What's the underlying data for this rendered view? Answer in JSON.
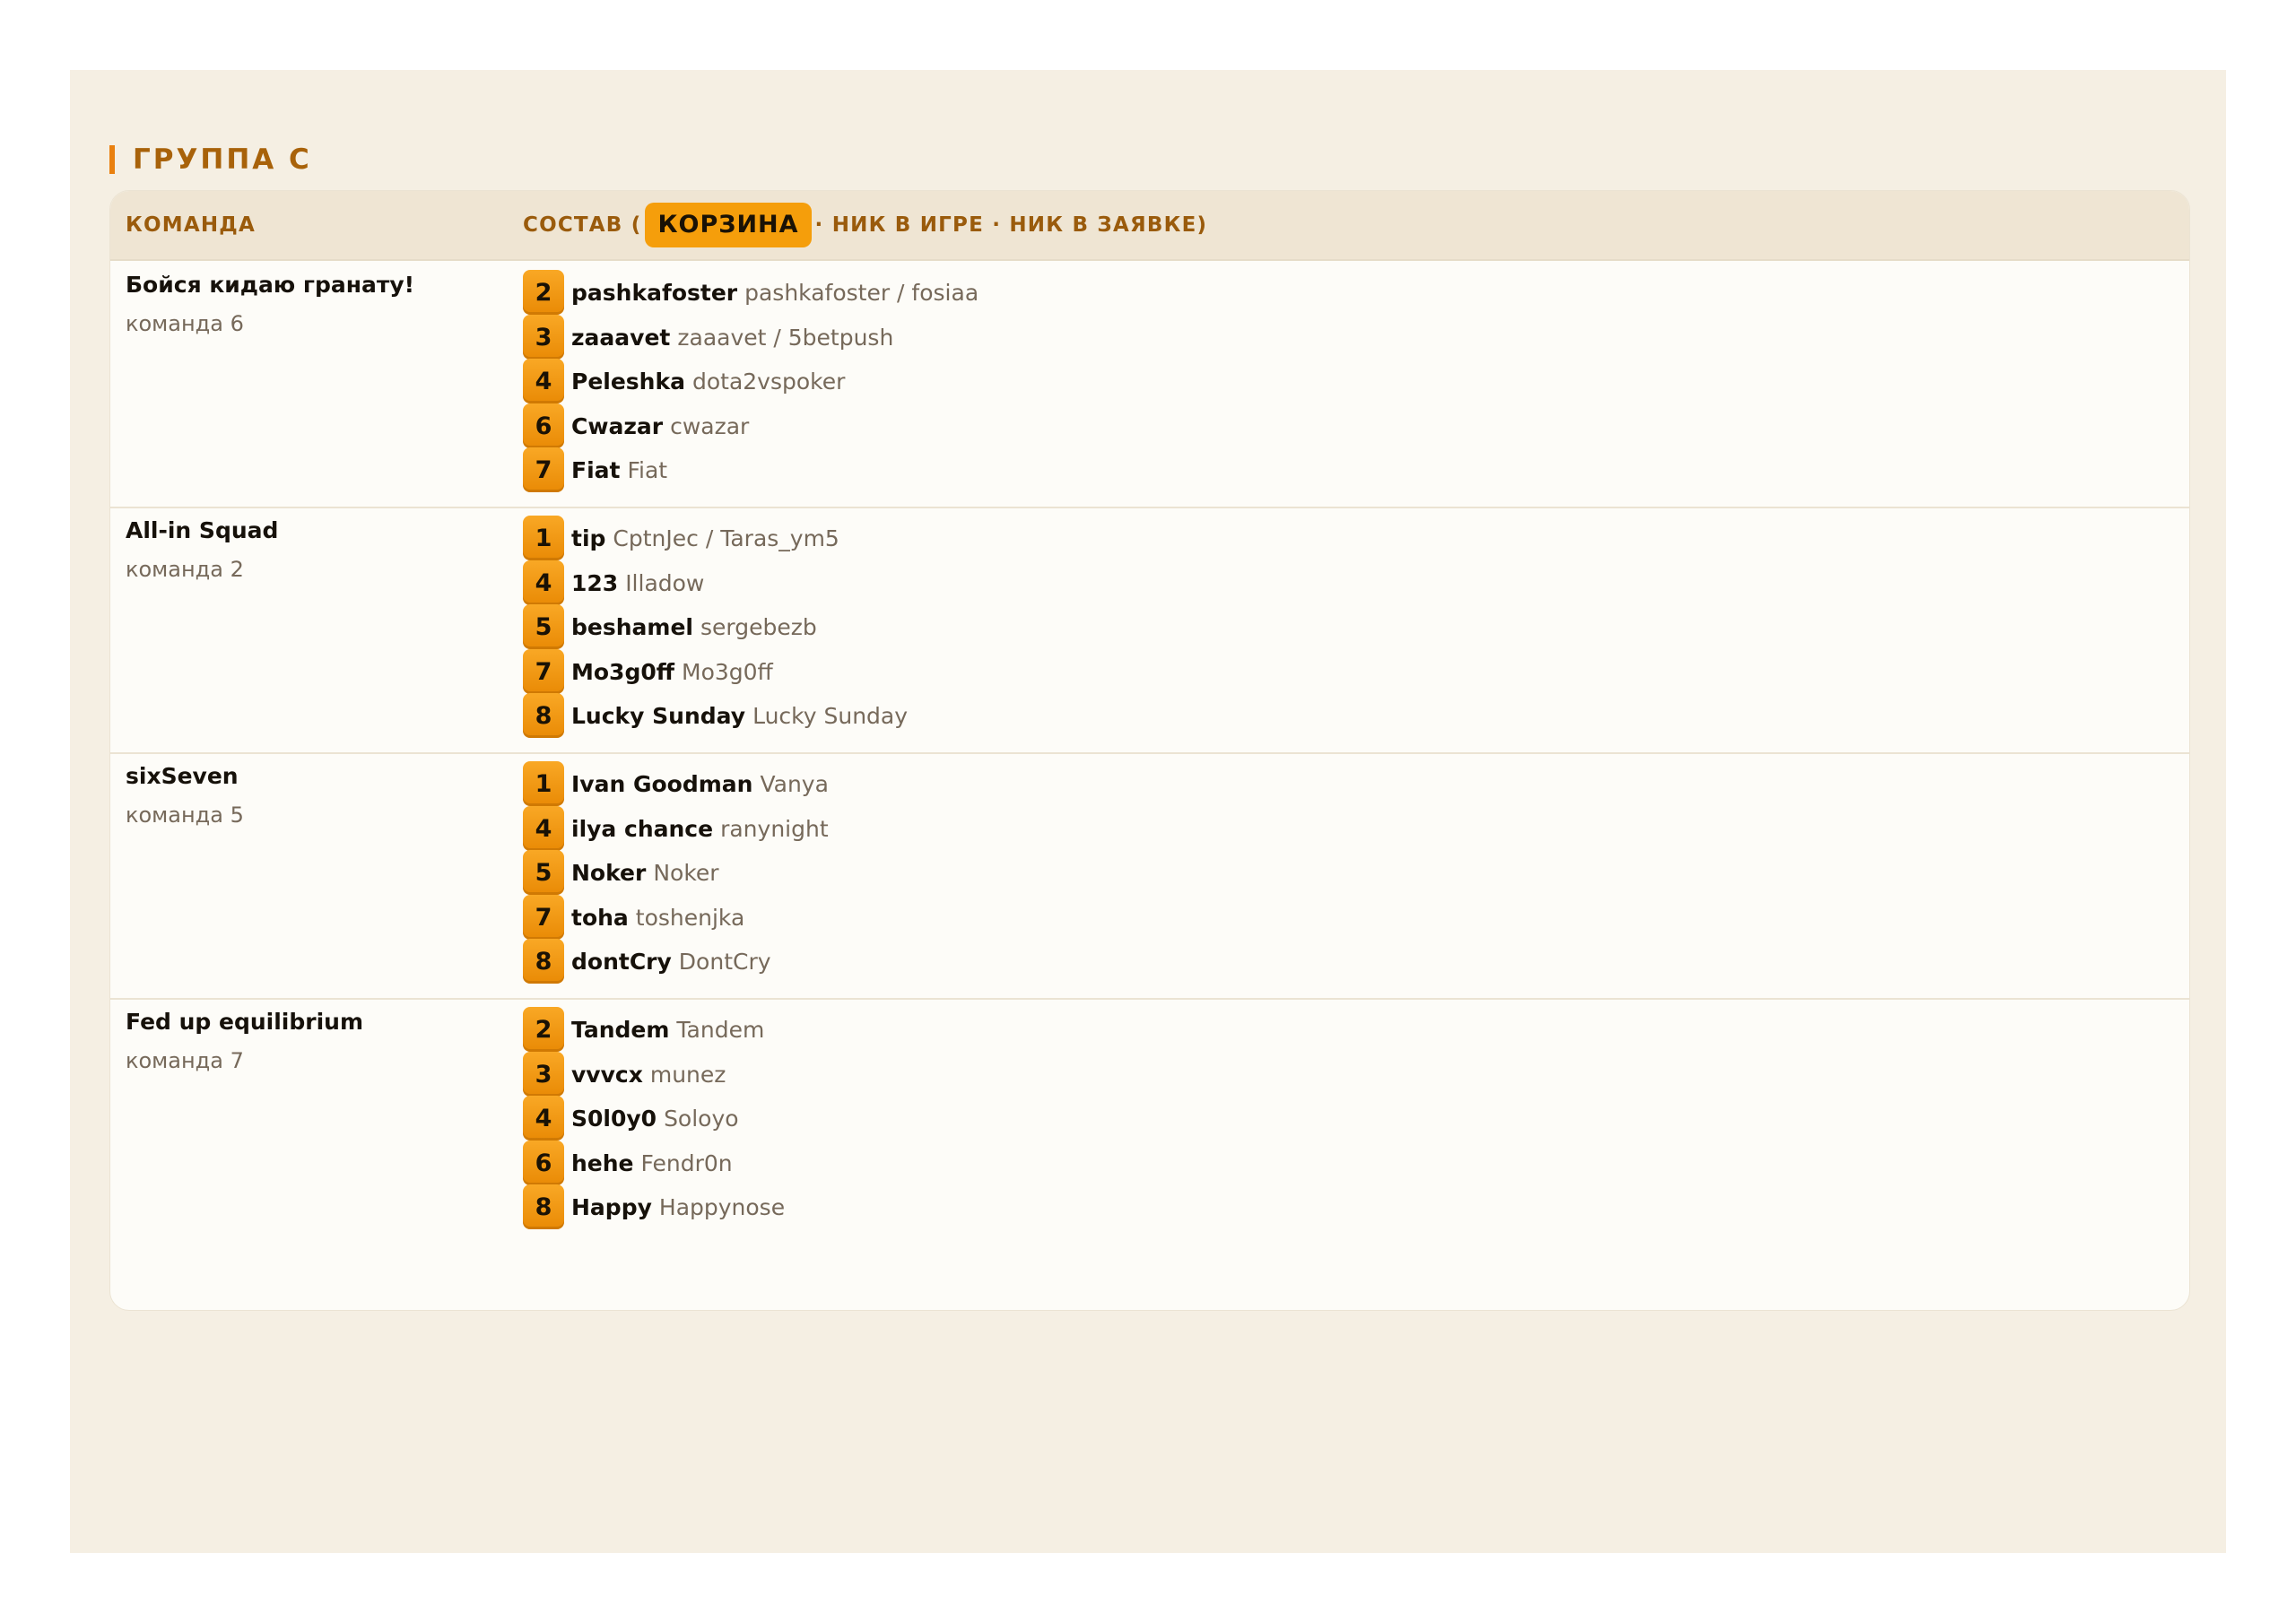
{
  "group": {
    "title": "ГРУППА C"
  },
  "table": {
    "header": {
      "team": "КОМАНДА",
      "roster_prefix": "СОСТАВ (",
      "roster_pill": "КОРЗИНА",
      "roster_suffix": "· НИК В ИГРЕ · НИК В ЗАЯВКЕ)"
    },
    "teams": [
      {
        "name": "Бойся кидаю гранату!",
        "sub": "команда 6",
        "players": [
          {
            "basket": "2",
            "nick": "pashkafoster",
            "info": "pashkafoster / fosiaa"
          },
          {
            "basket": "3",
            "nick": "zaaavet",
            "info": "zaaavet / 5betpush"
          },
          {
            "basket": "4",
            "nick": "Peleshka",
            "info": "dota2vspoker"
          },
          {
            "basket": "6",
            "nick": "Cwazar",
            "info": "cwazar"
          },
          {
            "basket": "7",
            "nick": "Fiat",
            "info": "Fiat"
          }
        ]
      },
      {
        "name": "All-in Squad",
        "sub": "команда 2",
        "players": [
          {
            "basket": "1",
            "nick": "tip",
            "info": "CptnJec / Taras_ym5"
          },
          {
            "basket": "4",
            "nick": "123",
            "info": "Illadow"
          },
          {
            "basket": "5",
            "nick": "beshamel",
            "info": "sergebezb"
          },
          {
            "basket": "7",
            "nick": "Mo3g0ff",
            "info": "Mo3g0ff"
          },
          {
            "basket": "8",
            "nick": "Lucky Sunday",
            "info": "Lucky Sunday"
          }
        ]
      },
      {
        "name": "sixSeven",
        "sub": "команда 5",
        "players": [
          {
            "basket": "1",
            "nick": "Ivan Goodman",
            "info": "Vanya"
          },
          {
            "basket": "4",
            "nick": "ilya chance",
            "info": "ranynight"
          },
          {
            "basket": "5",
            "nick": "Noker",
            "info": "Noker"
          },
          {
            "basket": "7",
            "nick": "toha",
            "info": "toshenjka"
          },
          {
            "basket": "8",
            "nick": "dontCry",
            "info": "DontCry"
          }
        ]
      },
      {
        "name": "Fed up equilibrium",
        "sub": "команда 7",
        "players": [
          {
            "basket": "2",
            "nick": "Tandem",
            "info": "Tandem"
          },
          {
            "basket": "3",
            "nick": "vvvcx",
            "info": "munez"
          },
          {
            "basket": "4",
            "nick": "S0l0y0",
            "info": "Soloyo"
          },
          {
            "basket": "6",
            "nick": "hehe",
            "info": "Fendr0n"
          },
          {
            "basket": "8",
            "nick": "Happy",
            "info": "Happynose"
          }
        ]
      }
    ]
  }
}
